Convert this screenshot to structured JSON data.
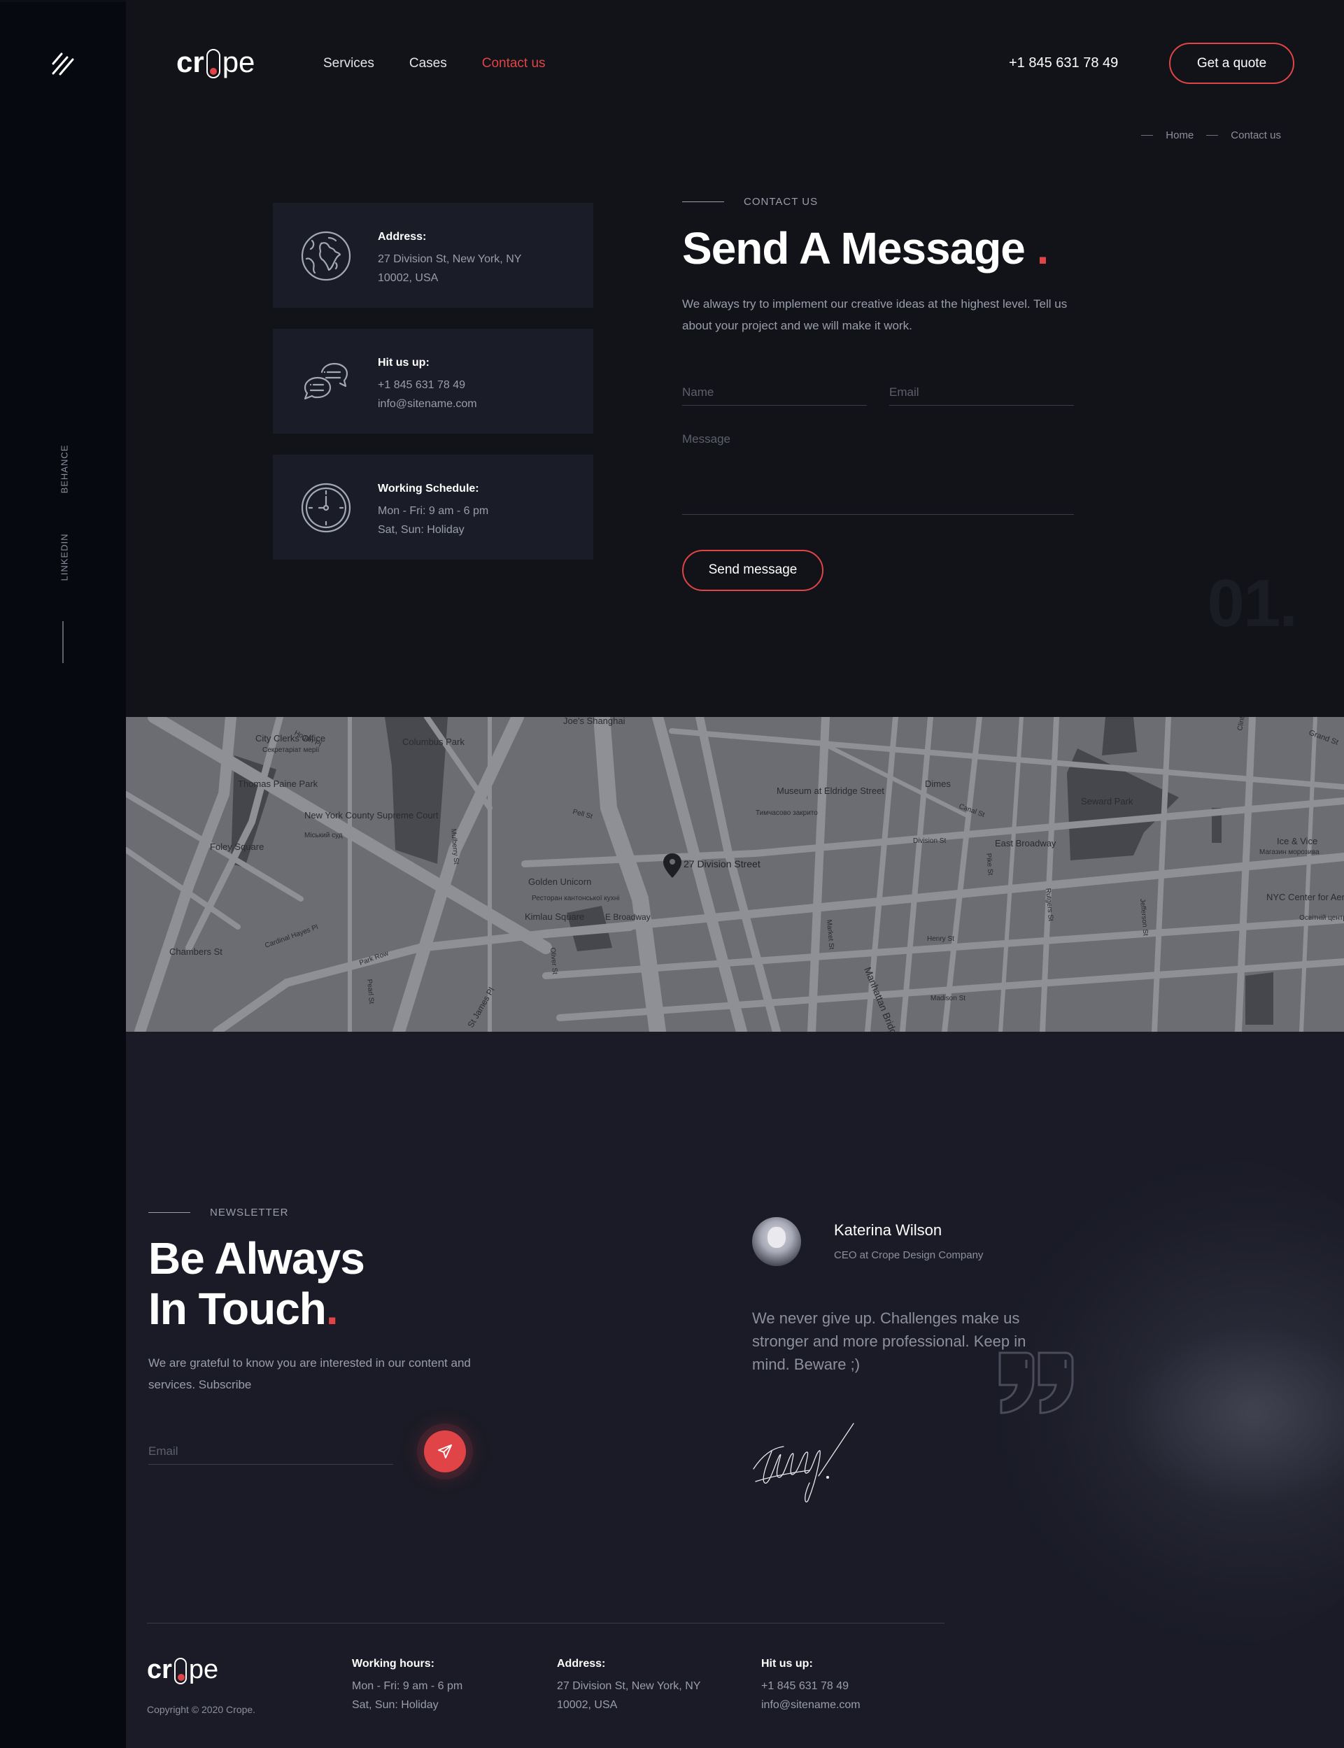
{
  "sidebar": {
    "menu_icon": "hamburger-slashes-icon",
    "social": [
      "BEHANCE",
      "LINKEDIN"
    ]
  },
  "brand": {
    "logo_left": "cr",
    "logo_right": "pe",
    "accent": "#e04446"
  },
  "header": {
    "nav": [
      {
        "label": "Services",
        "active": false
      },
      {
        "label": "Cases",
        "active": false
      },
      {
        "label": "Contact us",
        "active": true
      }
    ],
    "phone": "+1 845 631 78 49",
    "cta": "Get a quote"
  },
  "breadcrumb": [
    "Home",
    "Contact us"
  ],
  "info_cards": [
    {
      "icon": "globe-icon",
      "title": "Address:",
      "lines": [
        "27 Division St, New York, NY",
        "10002, USA"
      ]
    },
    {
      "icon": "chat-bubbles-icon",
      "title": "Hit us up:",
      "lines": [
        "+1 845 631 78 49",
        "info@sitename.com"
      ]
    },
    {
      "icon": "clock-icon",
      "title": "Working Schedule:",
      "lines": [
        "Mon - Fri: 9 am - 6 pm",
        "Sat, Sun: Holiday"
      ]
    }
  ],
  "contact": {
    "eyebrow": "CONTACT US",
    "title": "Send A Message",
    "title_dot": ".",
    "lead": "We always try to implement our creative ideas at the highest level. Tell us about your project and we will make it work.",
    "form": {
      "name_placeholder": "Name",
      "email_placeholder": "Email",
      "message_placeholder": "Message",
      "submit": "Send message"
    },
    "section_number": "01."
  },
  "map": {
    "pin_label": "27 Division Street",
    "labels": [
      "City Clerks Office",
      "Секретаріат мерії",
      "Columbus Park",
      "Joe's Shanghai",
      "Thomas Paine Park",
      "New York County Supreme Court",
      "Міський суд",
      "Foley Square",
      "Golden Unicorn",
      "Ресторан кантонської кухні",
      "Kimlau Square",
      "E Broadway",
      "Chambers St",
      "Museum at Eldridge Street",
      "Тимчасово закрито",
      "Dimes",
      "Seward Park",
      "East Broadway",
      "Ice & Vice",
      "Магазин морозива",
      "NYC Center for Aerospace and Applied...",
      "Освітній центр",
      "Manhattan Bridge",
      "Division St",
      "Canal St",
      "Henry St",
      "Madison St",
      "Pike St",
      "Market St",
      "Rutgers St",
      "Jefferson St",
      "Clinton St",
      "Park Row",
      "Pearl St",
      "Cardinal Hayes Pl",
      "Hogan Pl",
      "Mulberry St",
      "Pell St",
      "Oliver St",
      "St James Pl",
      "Grand St"
    ]
  },
  "newsletter": {
    "eyebrow": "NEWSLETTER",
    "title_line1": "Be Always",
    "title_line2": "In Touch",
    "title_dot": ".",
    "lead": "We are grateful to know you are interested in our content and services. Subscribe",
    "email_placeholder": "Email",
    "submit_icon": "paper-plane-icon"
  },
  "testimonial": {
    "name": "Katerina Wilson",
    "role": "CEO at Crope Design Company",
    "quote": "We never give up. Challenges make us stronger and more professional. Keep in mind. Beware ;)"
  },
  "footer": {
    "copyright": "Copyright © 2020 Crope.",
    "columns": [
      {
        "title": "Working hours:",
        "lines": [
          "Mon - Fri: 9 am - 6 pm",
          "Sat, Sun: Holiday"
        ]
      },
      {
        "title": "Address:",
        "lines": [
          "27 Division St, New York, NY",
          "10002, USA"
        ]
      },
      {
        "title": "Hit us up:",
        "lines": [
          "+1 845 631 78 49",
          "info@sitename.com"
        ]
      }
    ]
  }
}
